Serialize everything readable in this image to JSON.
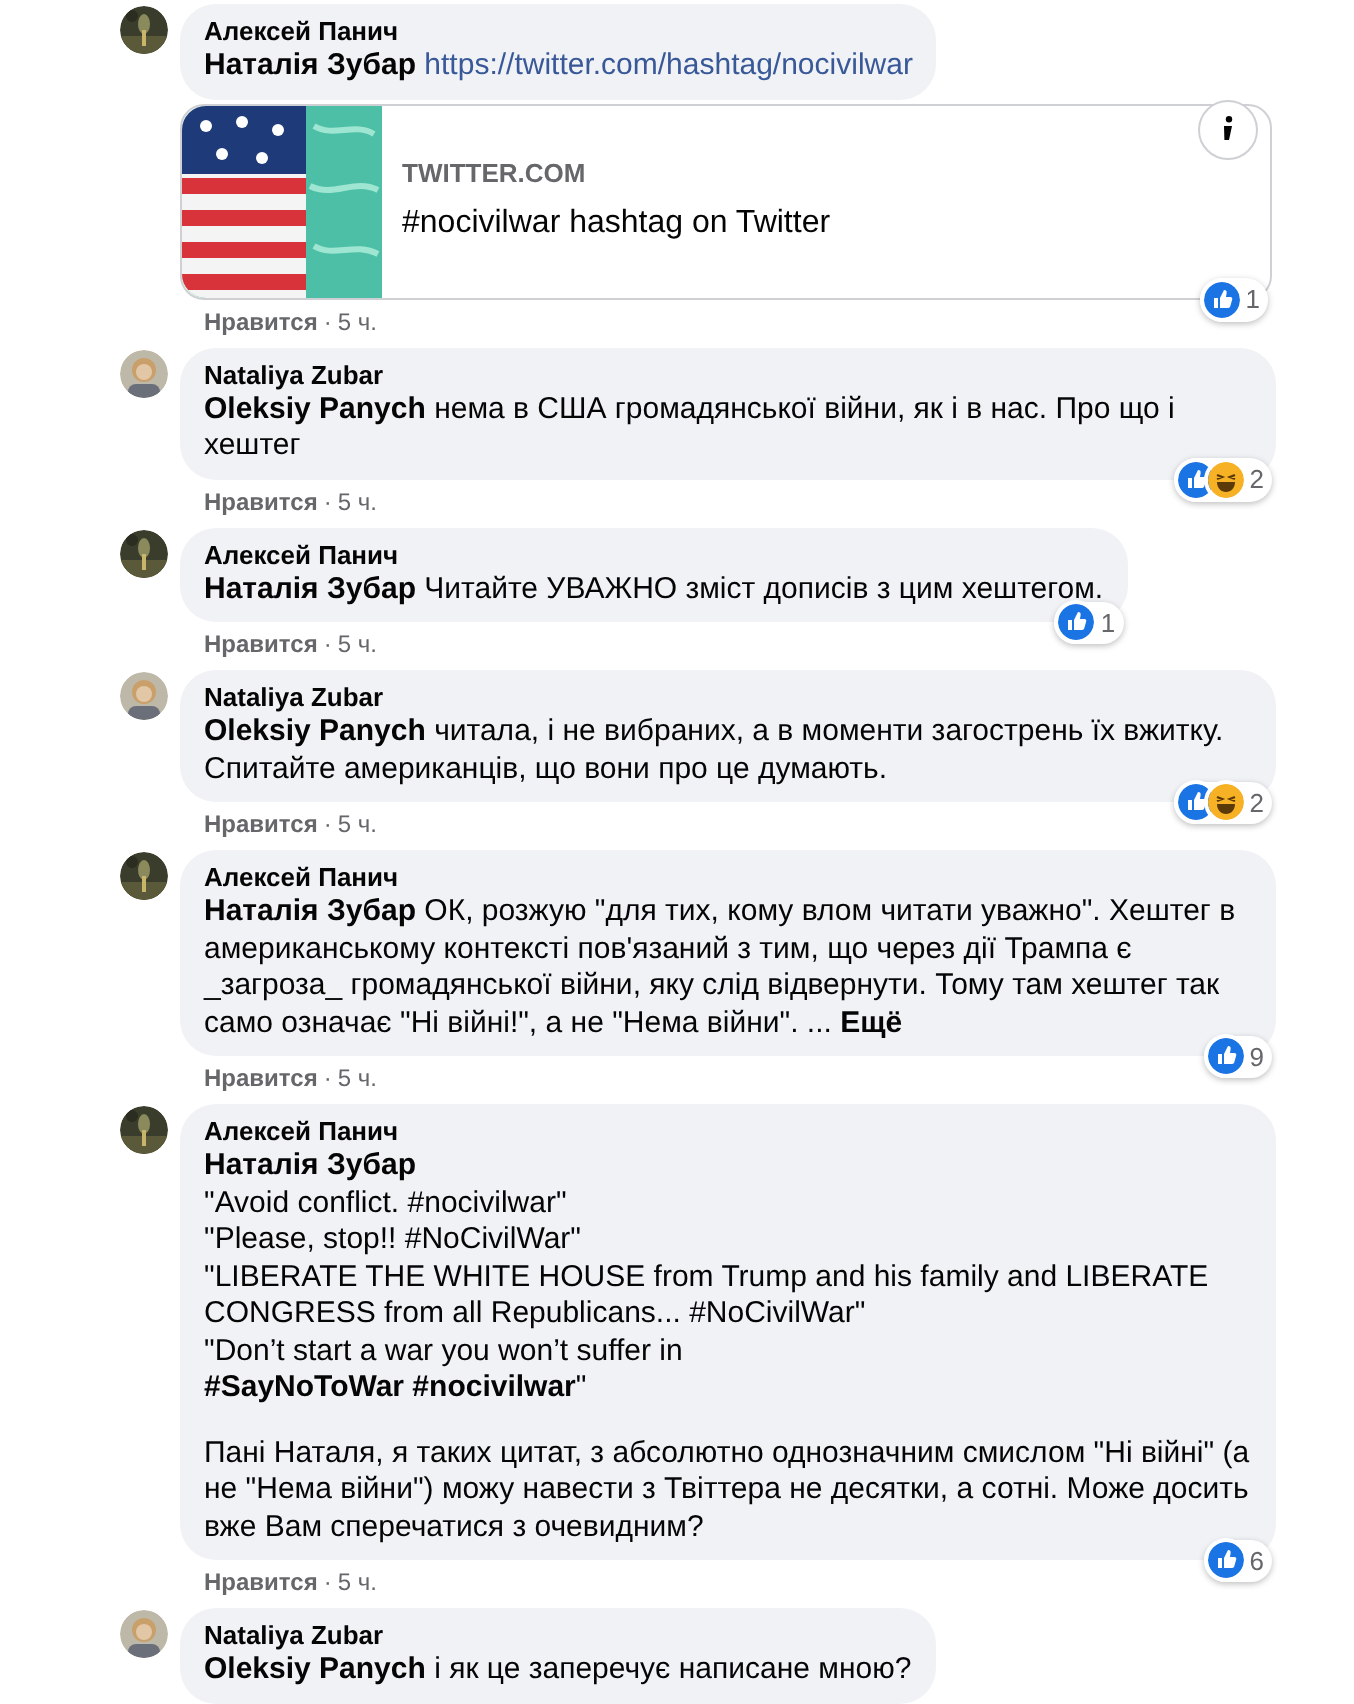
{
  "comments": [
    {
      "author": "Алексей Панич",
      "paragraphs": [
        {
          "lines": [
            "**Наталія Зубар**"
          ],
          "link": {
            "kind": "url",
            "text": "https://twitter.com/hashtag/nocivilwar"
          }
        }
      ],
      "preview": {
        "domain": "TWITTER.COM",
        "title": "#nocivilwar hashtag on Twitter"
      },
      "reactions": {
        "icons": [
          {
            "kind": "like"
          }
        ],
        "count": "1"
      },
      "like_label": "Нравится",
      "separator": "·",
      "time": "5 ч."
    },
    {
      "author": "Nataliya Zubar",
      "paragraphs": [
        {
          "lines": [
            "**Oleksiy Panych** нема в США громадянської війни, як і в нас. Про що і хештег"
          ]
        }
      ],
      "reactions": {
        "icons": [
          {
            "kind": "like"
          },
          {
            "kind": "haha"
          }
        ],
        "count": "2"
      },
      "like_label": "Нравится",
      "separator": "·",
      "time": "5 ч."
    },
    {
      "author": "Алексей Панич",
      "paragraphs": [
        {
          "lines": [
            "**Наталія Зубар** Читайте УВАЖНО зміст дописів з цим хештегом."
          ]
        }
      ],
      "reactions": {
        "icons": [
          {
            "kind": "like"
          }
        ],
        "count": "1"
      },
      "like_label": "Нравится",
      "separator": "·",
      "time": "5 ч."
    },
    {
      "author": "Nataliya Zubar",
      "paragraphs": [
        {
          "lines": [
            "**Oleksiy Panych** читала, і не вибраних, а в моменти загострень їх вжитку. Спитайте американців, що вони про це думають."
          ]
        }
      ],
      "reactions": {
        "icons": [
          {
            "kind": "like"
          },
          {
            "kind": "haha"
          }
        ],
        "count": "2"
      },
      "like_label": "Нравится",
      "separator": "·",
      "time": "5 ч."
    },
    {
      "author": "Алексей Панич",
      "paragraphs": [
        {
          "lines": [
            "**Наталія Зубар** ОК, розжую \"для тих, кому влом читати уважно\". Хештег в американському контексті пов'язаний з тим, що через дії Трампа є _загроза_ громадянської війни, яку слід відвернути. Тому там хештег так само означає \"Ні війні!\", а не \"Нема війни\". ..."
          ],
          "link": {
            "kind": "more",
            "text": "Ещё"
          }
        }
      ],
      "reactions": {
        "icons": [
          {
            "kind": "like"
          }
        ],
        "count": "9"
      },
      "like_label": "Нравится",
      "separator": "·",
      "time": "5 ч."
    },
    {
      "author": "Алексей Панич",
      "paragraphs": [
        {
          "lines": [
            "**Наталія Зубар**",
            "\"Avoid conflict. #nocivilwar\"",
            "\"Please, stop!! #NoCivilWar\"",
            "\"LIBERATE THE WHITE HOUSE from Trump and his family and LIBERATE CONGRESS from all Republicans... #NoCivilWar\"",
            "\"Don’t start a war you won’t suffer in",
            "**#SayNoToWar #nocivilwar**\""
          ]
        },
        {
          "lines": [
            "Пані Наталя, я таких цитат, з абсолютно однозначним смислом \"Ні війні\" (а не \"Нема війни\") можу навести з Твіттера не десятки, а сотні. Може досить вже Вам сперечатися з очевидним?"
          ]
        }
      ],
      "reactions": {
        "icons": [
          {
            "kind": "like"
          }
        ],
        "count": "6"
      },
      "like_label": "Нравится",
      "separator": "·",
      "time": "5 ч."
    },
    {
      "author": "Nataliya Zubar",
      "paragraphs": [
        {
          "lines": [
            "**Oleksiy Panych** і як це заперечує написане мною?"
          ]
        }
      ]
    }
  ]
}
